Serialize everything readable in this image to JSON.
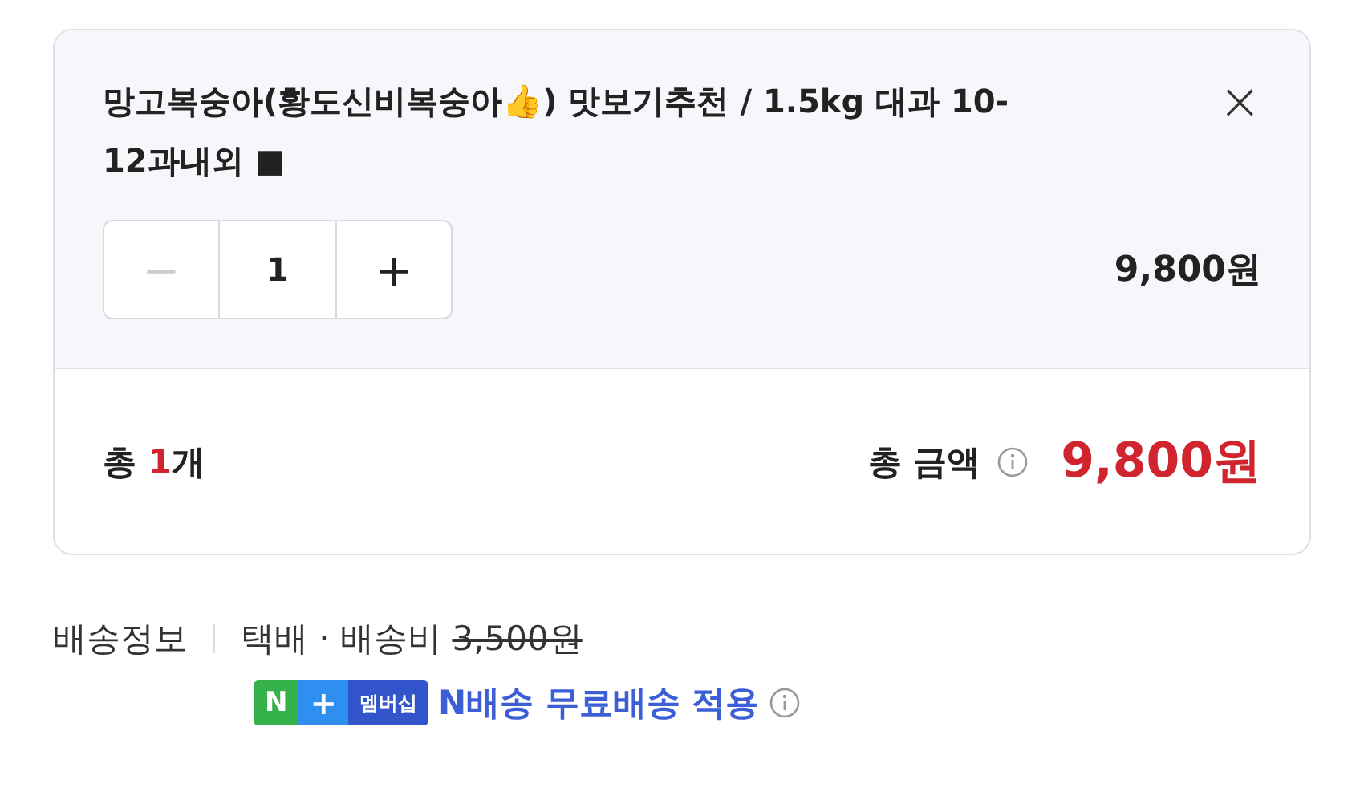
{
  "item": {
    "title": "망고복숭아(황도신비복숭아👍) 맛보기추천 / 1.5kg 대과 10-12과내외 ■",
    "close": "×",
    "quantity": {
      "minus": "−",
      "value": "1",
      "plus": "+",
      "minus_disabled": true
    },
    "price": "9,800원"
  },
  "summary": {
    "count_prefix": "총 ",
    "count": "1",
    "count_suffix": "개",
    "total_label": "총 금액",
    "total": "9,800원"
  },
  "delivery": {
    "label": "배송정보",
    "method": "택배 · 배송비",
    "fee": "3,500원",
    "fee_struck": true,
    "badge": {
      "n": "N",
      "plus": "+",
      "membership": "멤버십"
    },
    "benefit": "N배송 무료배송 적용"
  }
}
